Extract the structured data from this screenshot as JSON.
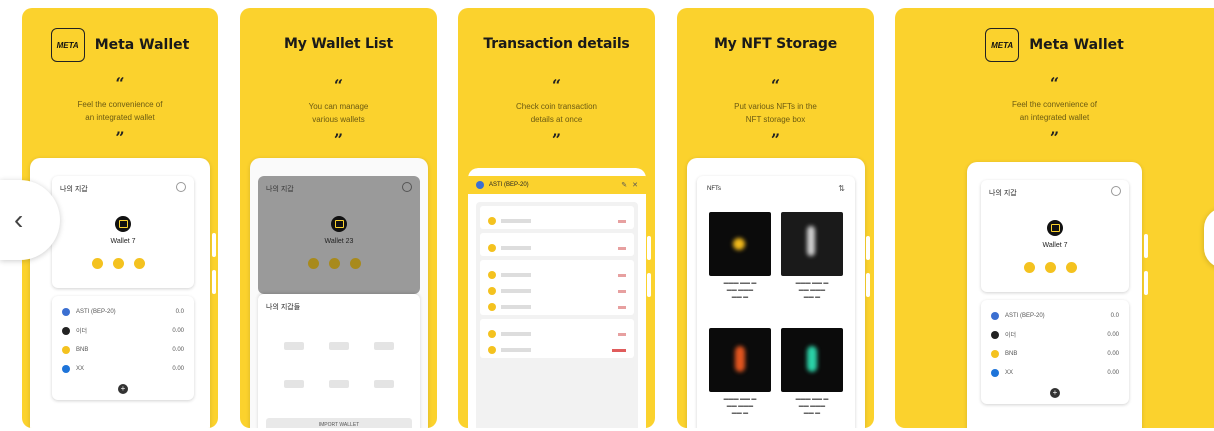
{
  "nav": {
    "prev_glyph": "‹"
  },
  "cards": [
    {
      "brand_logo": "META",
      "title": "Meta Wallet",
      "tagline_1": "Feel the convenience of",
      "tagline_2": "an integrated wallet",
      "open_quote": "“",
      "close_quote": "”",
      "screen": {
        "header": "나의 지갑",
        "wallet_name": "Wallet 7",
        "coins": [
          {
            "name": "ASTI (BEP-20)",
            "value": "0.0",
            "color": "#3b6fd1"
          },
          {
            "name": "이더",
            "value": "0.00",
            "color": "#222222"
          },
          {
            "name": "BNB",
            "value": "0.00",
            "color": "#f4c21f"
          },
          {
            "name": "XX",
            "value": "0.00",
            "color": "#1e74d9"
          }
        ]
      }
    },
    {
      "title": "My Wallet List",
      "tagline_1": "You can manage",
      "tagline_2": "various wallets",
      "open_quote": "“",
      "close_quote": "”",
      "screen": {
        "header": "나의 지갑",
        "wallet_name": "Wallet 23",
        "list_title": "나의 지갑들",
        "import_label": "IMPORT WALLET"
      }
    },
    {
      "title": "Transaction details",
      "tagline_1": "Check coin transaction",
      "tagline_2": "details at once",
      "open_quote": "“",
      "close_quote": "”",
      "screen": {
        "header": "ASTI (BEP-20)"
      }
    },
    {
      "title": "My NFT Storage",
      "tagline_1": "Put various NFTs in the",
      "tagline_2": "NFT storage box",
      "open_quote": "“",
      "close_quote": "”",
      "screen": {
        "header": "NFTs"
      }
    },
    {
      "brand_logo": "META",
      "title": "Meta Wallet",
      "tagline_1": "Feel the convenience of",
      "tagline_2": "an integrated wallet",
      "open_quote": "“",
      "close_quote": "”",
      "screen": {
        "header": "나의 지갑",
        "wallet_name": "Wallet 7",
        "coins": [
          {
            "name": "ASTI (BEP-20)",
            "value": "0.0",
            "color": "#3b6fd1"
          },
          {
            "name": "이더",
            "value": "0.00",
            "color": "#222222"
          },
          {
            "name": "BNB",
            "value": "0.00",
            "color": "#f4c21f"
          },
          {
            "name": "XX",
            "value": "0.00",
            "color": "#1e74d9"
          }
        ]
      }
    }
  ]
}
